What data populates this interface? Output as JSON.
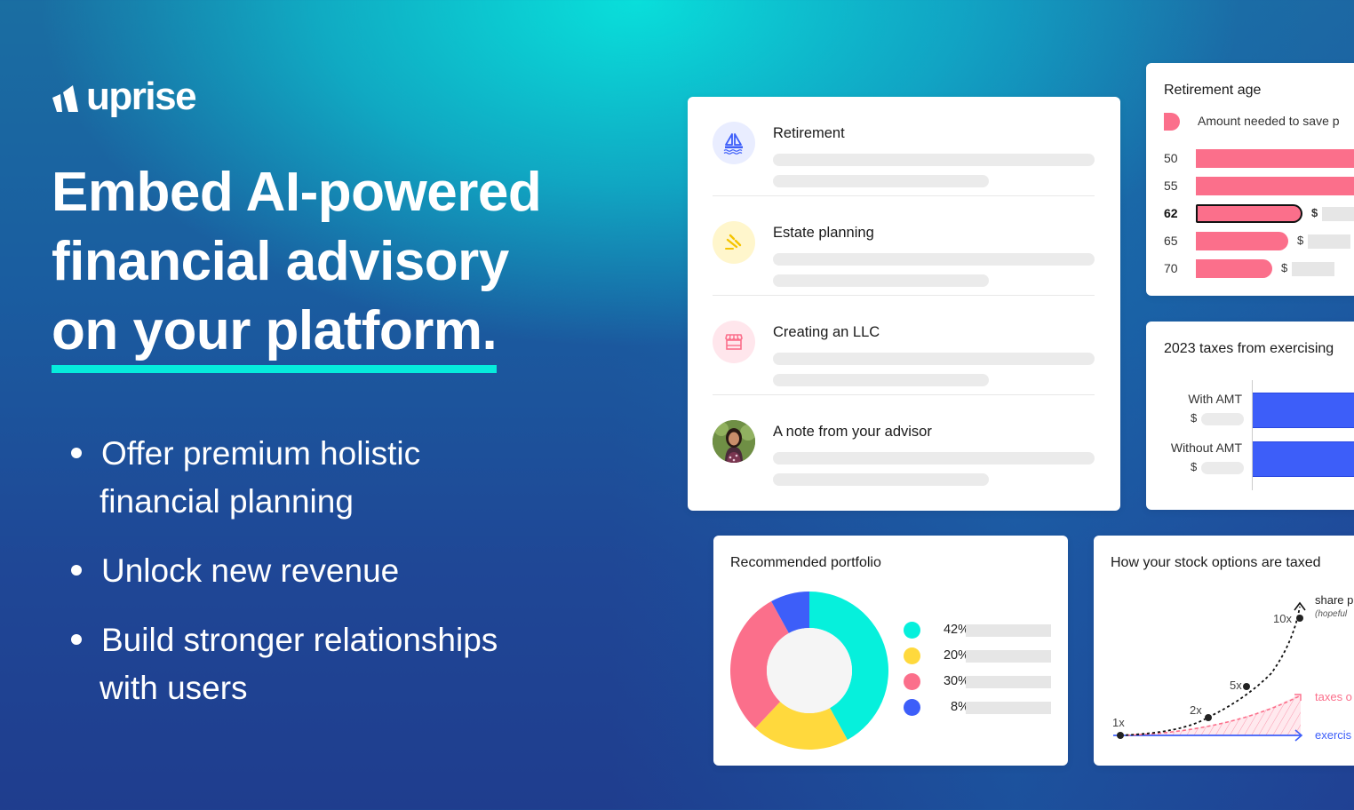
{
  "brand": {
    "name": "uprise",
    "logo_icon": "uprise-logo-mark",
    "accent_color": "#06ecdc"
  },
  "hero": {
    "headline_lines": [
      "Embed AI-powered",
      "financial advisory",
      "on your platform."
    ],
    "bullets": [
      {
        "line1": "Offer premium holistic",
        "line2": "financial planning"
      },
      {
        "line1": "Unlock new revenue",
        "line2": ""
      },
      {
        "line1": "Build stronger relationships",
        "line2": "with users"
      }
    ]
  },
  "topics_card": {
    "items": [
      {
        "label": "Retirement",
        "icon": "sailboat-icon",
        "icon_bg": "#e9edff",
        "icon_color": "#3d5ef9"
      },
      {
        "label": "Estate planning",
        "icon": "gavel-icon",
        "icon_bg": "#fff6cc",
        "icon_color": "#f5c400"
      },
      {
        "label": "Creating an LLC",
        "icon": "storefront-icon",
        "icon_bg": "#ffe6ec",
        "icon_color": "#fb6f8b"
      },
      {
        "label": "A note from your advisor",
        "icon": "advisor-avatar",
        "icon_bg": "#5b7a3a",
        "icon_color": "#ffffff"
      }
    ]
  },
  "retirement_card": {
    "title": "Retirement age",
    "legend_label": "Amount needed to save p",
    "bar_color": "#fb6f8b",
    "rows": [
      {
        "age": "50",
        "relative_amount": 1.0,
        "selected": false,
        "dollar": ""
      },
      {
        "age": "55",
        "relative_amount": 1.0,
        "selected": false,
        "dollar": ""
      },
      {
        "age": "62",
        "relative_amount": 0.6,
        "selected": true,
        "dollar": "$"
      },
      {
        "age": "65",
        "relative_amount": 0.52,
        "selected": false,
        "dollar": "$"
      },
      {
        "age": "70",
        "relative_amount": 0.43,
        "selected": false,
        "dollar": "$"
      }
    ]
  },
  "taxes_card": {
    "title": "2023 taxes from exercising",
    "bar_color": "#3d5ef9",
    "rows": [
      {
        "label": "With AMT",
        "dollar": "$"
      },
      {
        "label": "Without AMT",
        "dollar": "$"
      }
    ]
  },
  "portfolio_card": {
    "title": "Recommended portfolio",
    "slices": [
      {
        "pct_label": "42%",
        "value": 42,
        "color": "#06f0dc"
      },
      {
        "pct_label": "20%",
        "value": 20,
        "color": "#ffd93d"
      },
      {
        "pct_label": "30%",
        "value": 30,
        "color": "#fb6f8b"
      },
      {
        "pct_label": "8%",
        "value": 8,
        "color": "#3d5ef9"
      }
    ],
    "center_color": "#f5f5f5"
  },
  "stock_card": {
    "title": "How your stock options are taxed",
    "multipliers": [
      "1x",
      "2x",
      "5x",
      "10x"
    ],
    "line_labels": {
      "share_price": "share p",
      "share_price_note": "(hopeful",
      "taxes": "taxes o",
      "exercise": "exercis"
    },
    "colors": {
      "share_price": "#111111",
      "taxes": "#fb6f8b",
      "exercise": "#3d5ef9"
    }
  }
}
